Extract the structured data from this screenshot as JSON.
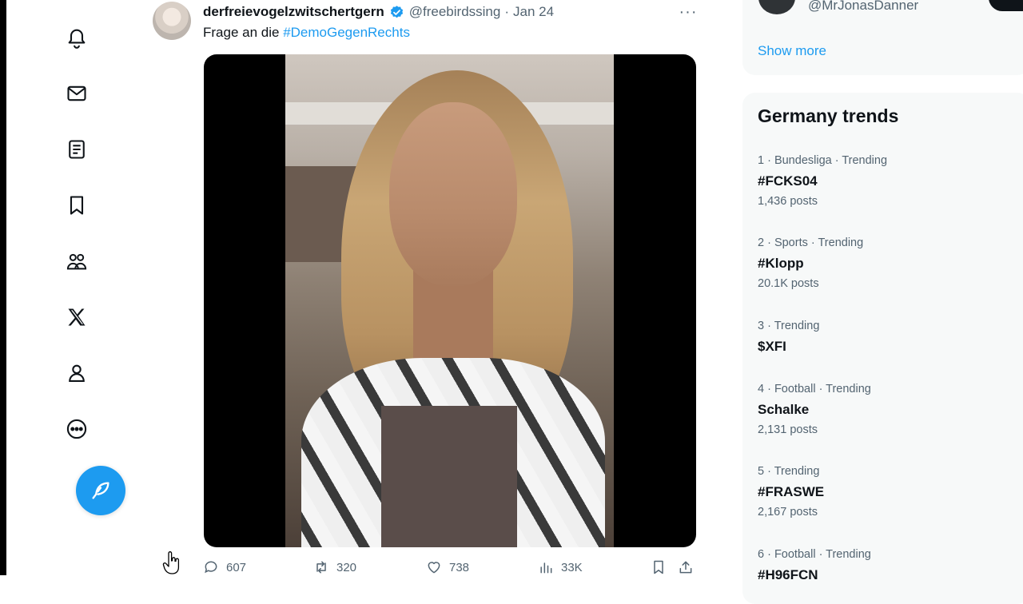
{
  "tweet": {
    "display_name": "derfreievogelzwitschertgern",
    "handle": "@freebirdssing",
    "separator": "·",
    "date": "Jan 24",
    "more_label": "···",
    "text_prefix": "Frage an die ",
    "hashtag": "#DemoGegenRechts",
    "actions": {
      "replies": "607",
      "reposts": "320",
      "likes": "738",
      "views": "33K"
    }
  },
  "sidebar": {
    "who_to_follow_handle": "@MrJonasDanner",
    "show_more": "Show more",
    "trends_title": "Germany trends",
    "trends": [
      {
        "meta": "1 · Bundesliga · Trending",
        "name": "#FCKS04",
        "count": "1,436 posts"
      },
      {
        "meta": "2 · Sports · Trending",
        "name": "#Klopp",
        "count": "20.1K posts"
      },
      {
        "meta": "3 · Trending",
        "name": "$XFI",
        "count": ""
      },
      {
        "meta": "4 · Football · Trending",
        "name": "Schalke",
        "count": "2,131 posts"
      },
      {
        "meta": "5 · Trending",
        "name": "#FRASWE",
        "count": "2,167 posts"
      },
      {
        "meta": "6 · Football · Trending",
        "name": "#H96FCN",
        "count": ""
      }
    ]
  },
  "nav_icons": [
    "notifications-icon",
    "messages-icon",
    "lists-icon",
    "bookmarks-icon",
    "communities-icon",
    "x-premium-icon",
    "profile-icon",
    "more-icon"
  ],
  "colors": {
    "accent": "#1d9bf0",
    "text": "#0f1419",
    "secondary": "#536471",
    "card_bg": "#f7f9f9"
  }
}
